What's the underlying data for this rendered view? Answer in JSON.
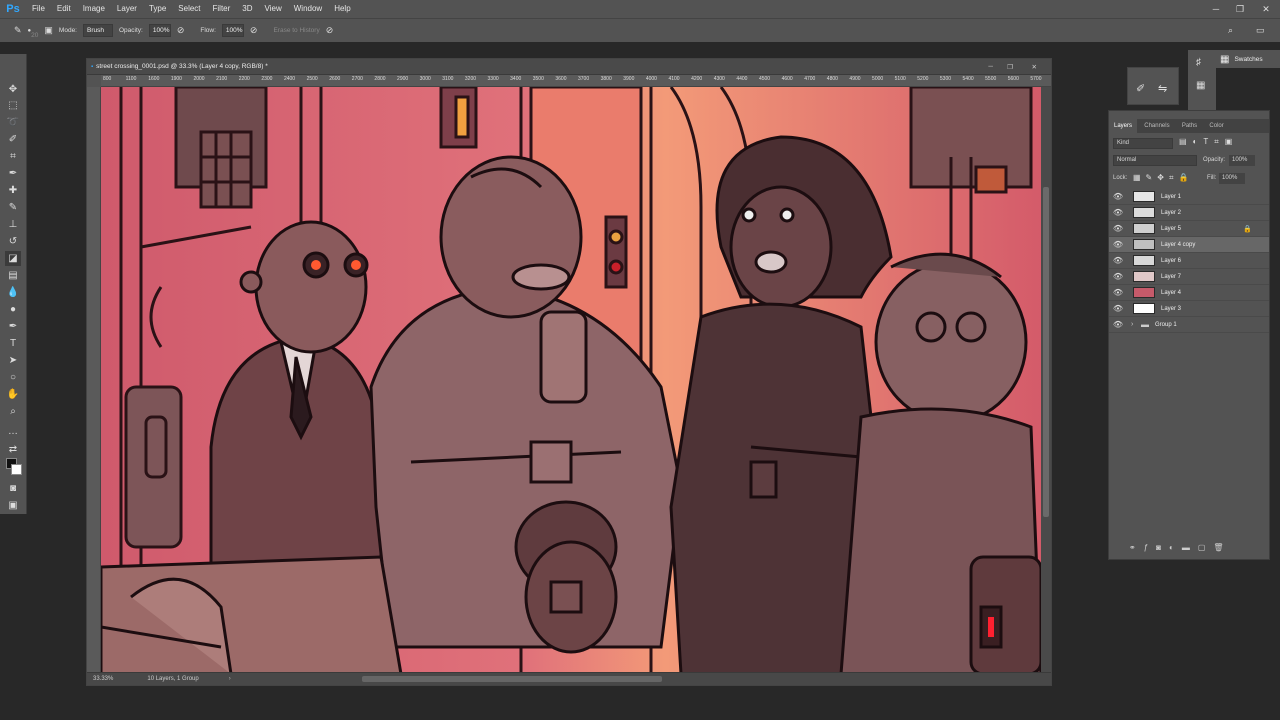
{
  "app": {
    "logo": "Ps"
  },
  "menu": [
    "File",
    "Edit",
    "Image",
    "Layer",
    "Type",
    "Select",
    "Filter",
    "3D",
    "View",
    "Window",
    "Help"
  ],
  "options": {
    "brush_size": "20",
    "mode_label": "Mode:",
    "mode_value": "Brush",
    "opacity_label": "Opacity:",
    "opacity_value": "100%",
    "flow_label": "Flow:",
    "flow_value": "100%",
    "erase_history": "Erase to History"
  },
  "document": {
    "title": "street crossing_0001.psd @ 33.3% (Layer 4 copy, RGB/8) *",
    "zoom": "33.33%",
    "status": "10 Layers, 1 Group",
    "ruler_ticks": [
      "800",
      "1100",
      "1600",
      "1900",
      "2000",
      "2100",
      "2200",
      "2300",
      "2400",
      "2500",
      "2600",
      "2700",
      "2800",
      "2900",
      "3000",
      "3100",
      "3200",
      "3300",
      "3400",
      "3500",
      "3600",
      "3700",
      "3800",
      "3900",
      "4000",
      "4100",
      "4200",
      "4300",
      "4400",
      "4500",
      "4600",
      "4700",
      "4800",
      "4900",
      "5000",
      "5100",
      "5200",
      "5300",
      "5400",
      "5500",
      "5600",
      "5700"
    ]
  },
  "right_dock": {
    "swatches": "Swatches"
  },
  "layers_panel": {
    "tabs": [
      "Layers",
      "Channels",
      "Paths",
      "Color"
    ],
    "filter_kind": "Kind",
    "blend_mode": "Normal",
    "opacity_label": "Opacity:",
    "opacity_value": "100%",
    "lock_label": "Lock:",
    "fill_label": "Fill:",
    "fill_value": "100%",
    "layers": [
      {
        "name": "Layer 1",
        "thumb": "#e6e6e6",
        "selected": false
      },
      {
        "name": "Layer 2",
        "thumb": "#dcdcdc",
        "selected": false
      },
      {
        "name": "Layer 5",
        "thumb": "#cfcfcf",
        "selected": false,
        "locked": true
      },
      {
        "name": "Layer 4 copy",
        "thumb": "#bfbfbf",
        "selected": true
      },
      {
        "name": "Layer 6",
        "thumb": "#d8d8d8",
        "selected": false
      },
      {
        "name": "Layer 7",
        "thumb": "#e0c8c8",
        "selected": false
      },
      {
        "name": "Layer 4",
        "thumb": "#c65a6a",
        "selected": false
      },
      {
        "name": "Layer 3",
        "thumb": "#ffffff",
        "selected": false
      },
      {
        "name": "Group 1",
        "thumb": "",
        "selected": false,
        "group": true
      }
    ]
  },
  "colors": {
    "accent": "#31a8ff",
    "canvas_pink": "#d66a78"
  }
}
